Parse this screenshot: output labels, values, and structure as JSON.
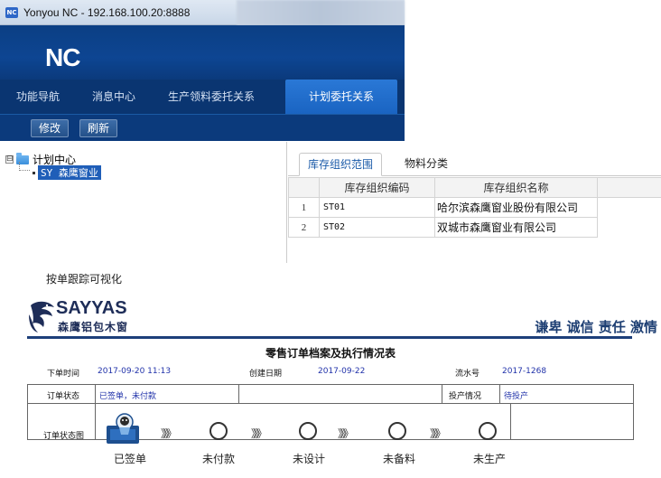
{
  "window": {
    "title": "Yonyou NC - 192.168.100.20:8888",
    "app_icon": "nc-icon"
  },
  "header": {
    "logo": "NC"
  },
  "nav": {
    "items": [
      {
        "label": "功能导航"
      },
      {
        "label": "消息中心"
      },
      {
        "label": "生产领料委托关系"
      },
      {
        "label": "计划委托关系",
        "active": true
      }
    ]
  },
  "toolbar": {
    "edit_label": "修改",
    "refresh_label": "刷新"
  },
  "tree": {
    "expander": "⊟",
    "root_label": "计划中心",
    "child_label": "SY 森鹰窗业"
  },
  "tabs": [
    {
      "label": "库存组织范围",
      "active": true
    },
    {
      "label": "物料分类",
      "active": false
    }
  ],
  "grid": {
    "headers": [
      "",
      "库存组织编码",
      "库存组织名称"
    ],
    "rows": [
      {
        "num": "1",
        "code": "ST01",
        "name": "哈尔滨森鹰窗业股份有限公司"
      },
      {
        "num": "2",
        "code": "ST02",
        "name": "双城市森鹰窗业有限公司"
      }
    ]
  },
  "caption": "按单跟踪可视化",
  "brand": {
    "name_en": "SAYYAS",
    "name_cn": "森鹰铝包木窗",
    "slogan": "谦卑 诚信 责任 激情"
  },
  "form": {
    "title": "零售订单档案及执行情况表",
    "order_time_label": "下单时间",
    "order_time_value": "2017-09-20 11:13",
    "created_date_label": "创建日期",
    "created_date_value": "2017-09-22",
    "serial_label": "流水号",
    "serial_value": "2017-1268",
    "status_label": "订单状态",
    "status_value": "已签单，未付款",
    "production_label": "投产情况",
    "production_value": "待投产",
    "status_chart_label": "订单状态图",
    "steps": [
      "已签单",
      "未付款",
      "未设计",
      "未备料",
      "未生产"
    ],
    "chevron": "》》》"
  },
  "colors": {
    "nc_blue": "#0d4592",
    "nav_active": "#1a64c2",
    "brand_navy": "#1e2d58",
    "form_value": "#2233aa"
  }
}
